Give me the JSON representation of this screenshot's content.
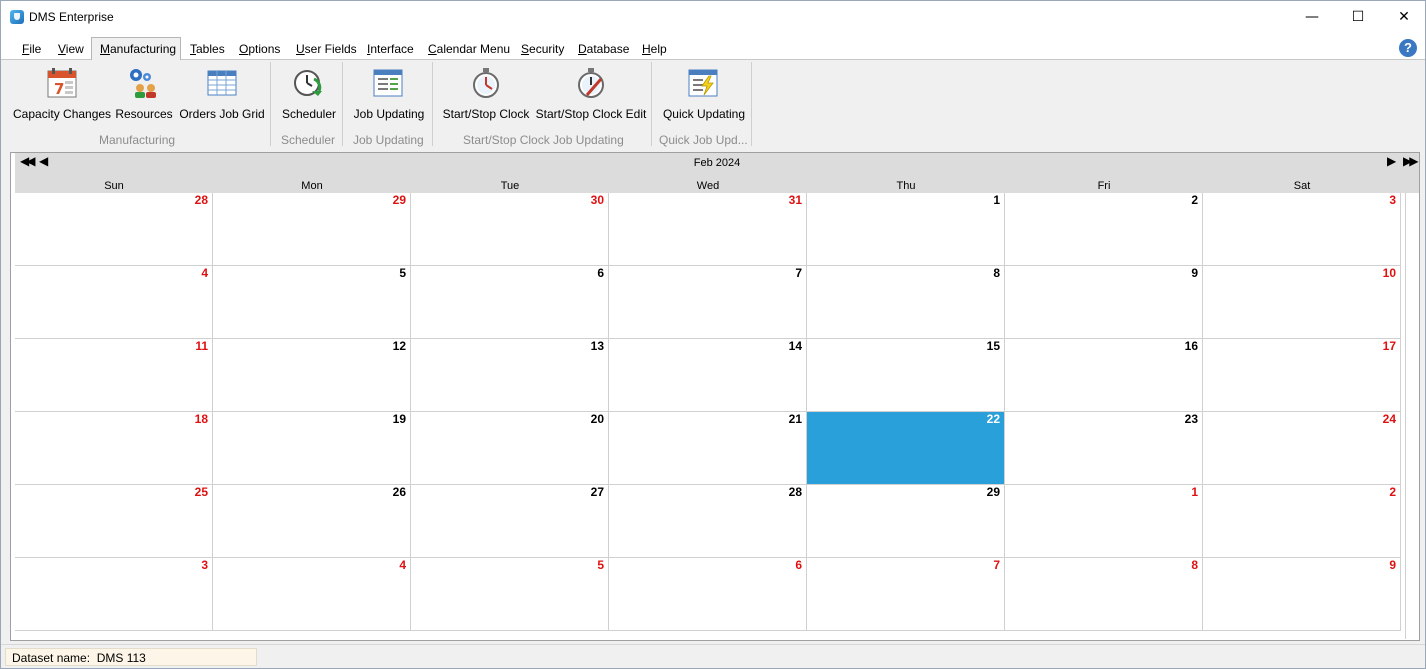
{
  "window": {
    "title": "DMS Enterprise",
    "minimize": "—",
    "maximize": "☐",
    "close": "✕"
  },
  "menu": {
    "items": [
      {
        "key": "F",
        "rest": "ile"
      },
      {
        "key": "V",
        "rest": "iew"
      },
      {
        "key": "M",
        "rest": "anufacturing"
      },
      {
        "key": "T",
        "rest": "ables"
      },
      {
        "key": "O",
        "rest": "ptions"
      },
      {
        "key": "U",
        "rest": "ser Fields"
      },
      {
        "key": "I",
        "rest": "nterface"
      },
      {
        "key": "C",
        "rest": "alendar Menu"
      },
      {
        "key": "S",
        "rest": "ecurity"
      },
      {
        "key": "D",
        "rest": "atabase"
      },
      {
        "key": "H",
        "rest": "elp"
      }
    ],
    "help_glyph": "?"
  },
  "ribbon": {
    "buttons": [
      {
        "label": "Capacity Changes",
        "icon": "calendar-icon"
      },
      {
        "label": "Resources",
        "icon": "resources-icon"
      },
      {
        "label": "Orders Job Grid",
        "icon": "grid-icon"
      },
      {
        "label": "Scheduler",
        "icon": "scheduler-icon"
      },
      {
        "label": "Job Updating",
        "icon": "job-updating-icon"
      },
      {
        "label": "Start/Stop Clock",
        "icon": "stopwatch-icon"
      },
      {
        "label": "Start/Stop Clock Edit",
        "icon": "stopwatch-edit-icon"
      },
      {
        "label": "Quick Updating",
        "icon": "quick-updating-icon"
      }
    ],
    "groups": [
      "Manufacturing",
      "Scheduler",
      "Job Updating",
      "Start/Stop Clock Job Updating",
      "Quick Job Upd..."
    ]
  },
  "calendar": {
    "month": "Feb 2024",
    "nav": {
      "first": "◀◀",
      "prev": "◀",
      "next": "▶",
      "last": "▶▶"
    },
    "weekdays": [
      "Sun",
      "Mon",
      "Tue",
      "Wed",
      "Thu",
      "Fri",
      "Sat"
    ],
    "weeks": [
      [
        "28",
        "29",
        "30",
        "31",
        "1",
        "2",
        "3"
      ],
      [
        "4",
        "5",
        "6",
        "7",
        "8",
        "9",
        "10"
      ],
      [
        "11",
        "12",
        "13",
        "14",
        "15",
        "16",
        "17"
      ],
      [
        "18",
        "19",
        "20",
        "21",
        "22",
        "23",
        "24"
      ],
      [
        "25",
        "26",
        "27",
        "28",
        "29",
        "1",
        "2"
      ],
      [
        "3",
        "4",
        "5",
        "6",
        "7",
        "8",
        "9"
      ]
    ],
    "selected": "22"
  },
  "status": {
    "label": "Dataset name:",
    "value": "DMS 113"
  }
}
